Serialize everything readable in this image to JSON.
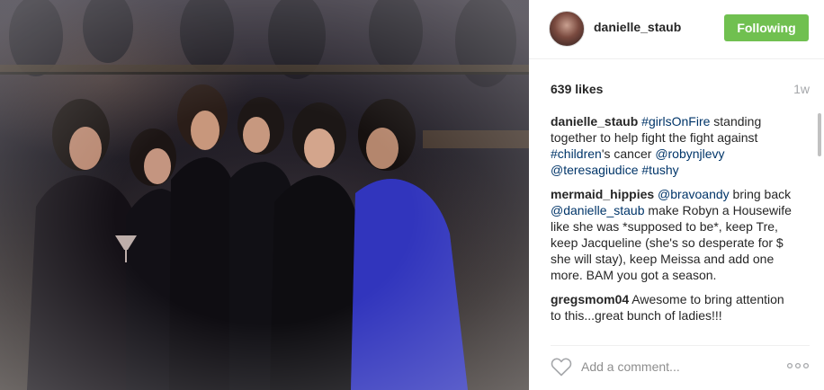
{
  "post": {
    "author": "danielle_staub",
    "follow_label": "Following",
    "likes": "639 likes",
    "age": "1w"
  },
  "comments": [
    {
      "user": "danielle_staub",
      "parts": [
        {
          "t": "tag",
          "v": "#girlsOnFire"
        },
        {
          "t": "txt",
          "v": " standing together to help fight the fight against "
        },
        {
          "t": "tag",
          "v": "#children"
        },
        {
          "t": "txt",
          "v": "'s cancer "
        },
        {
          "t": "tag",
          "v": "@robynjlevy"
        },
        {
          "t": "txt",
          "v": " "
        },
        {
          "t": "tag",
          "v": "@teresagiudice"
        },
        {
          "t": "txt",
          "v": " "
        },
        {
          "t": "tag",
          "v": "#tushy"
        }
      ]
    },
    {
      "user": "mermaid_hippies",
      "parts": [
        {
          "t": "tag",
          "v": "@bravoandy"
        },
        {
          "t": "txt",
          "v": " bring back "
        },
        {
          "t": "tag",
          "v": "@danielle_staub"
        },
        {
          "t": "txt",
          "v": " make Robyn a Housewife like she was *supposed to be*, keep Tre, keep Jacqueline (she's so desperate for $ she will stay), keep Meissa and add one more. BAM you got a season."
        }
      ]
    },
    {
      "user": "gregsmom04",
      "parts": [
        {
          "t": "txt",
          "v": "Awesome to bring attention to this...great bunch of ladies!!!"
        }
      ]
    }
  ],
  "footer": {
    "comment_placeholder": "Add a comment...",
    "like_icon": "heart-outline-icon",
    "more_icon": "ellipsis-icon"
  },
  "colors": {
    "follow_button": "#70c050",
    "link": "#003569",
    "muted": "#a5a7aa"
  }
}
